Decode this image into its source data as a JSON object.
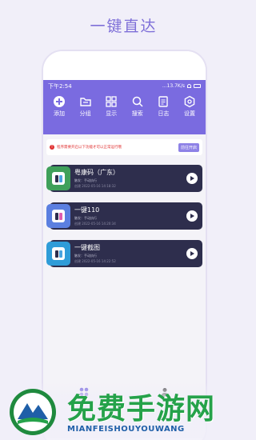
{
  "page": {
    "title": "一键直达"
  },
  "status_bar": {
    "time": "下午2:54",
    "speed": "...13.7K/s",
    "battery": ""
  },
  "toolbar": {
    "items": [
      {
        "label": "添加",
        "icon": "add-icon"
      },
      {
        "label": "分组",
        "icon": "folder-icon"
      },
      {
        "label": "显示",
        "icon": "grid-icon"
      },
      {
        "label": "搜索",
        "icon": "search-icon"
      },
      {
        "label": "日志",
        "icon": "log-icon"
      },
      {
        "label": "设置",
        "icon": "gear-icon"
      }
    ]
  },
  "notice": {
    "icon": "!",
    "text": "程序需要开启以下功能才可以正常运行哦",
    "button": "前往开启"
  },
  "cards": [
    {
      "title": "粤康码（广东）",
      "sub": "触发：手动执行",
      "time": "创建 2022-05-16 14:18:32",
      "icon_color": "#3fa05a"
    },
    {
      "title": "一键110",
      "sub": "触发：手动执行",
      "time": "创建 2022-05-16 14:20:34",
      "icon_color": "#5b7fe0"
    },
    {
      "title": "一键截图",
      "sub": "触发：手动执行",
      "time": "创建 2022-05-16 14:22:52",
      "icon_color": "#2f9cd8"
    }
  ],
  "watermark": {
    "title": "免费手游网",
    "subtitle": "MIANFEISHOUYOUWANG"
  },
  "colors": {
    "accent": "#7a6be0",
    "card_bg": "#2e2e4d",
    "notice_red": "#e03131",
    "watermark_green": "#25a24a",
    "watermark_blue": "#1f5fa8"
  }
}
